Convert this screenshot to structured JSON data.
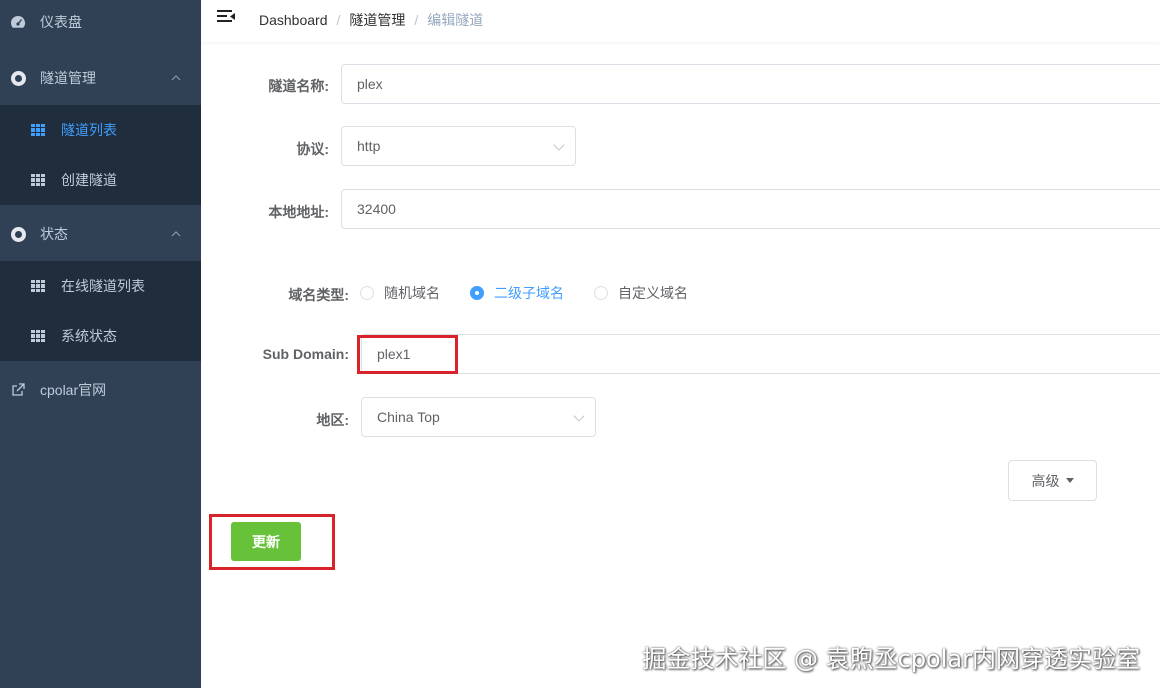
{
  "sidebar": {
    "dashboard": {
      "label": "仪表盘",
      "icon": "gauge-icon"
    },
    "tunnel_mgmt": {
      "label": "隧道管理",
      "icon": "lifebuoy-icon"
    },
    "tunnel_list": {
      "label": "隧道列表",
      "icon": "grid-icon",
      "active": true
    },
    "create_tunnel": {
      "label": "创建隧道",
      "icon": "grid-icon"
    },
    "status": {
      "label": "状态",
      "icon": "lifebuoy-icon"
    },
    "online_tunnels": {
      "label": "在线隧道列表",
      "icon": "grid-icon"
    },
    "system_status": {
      "label": "系统状态",
      "icon": "grid-icon"
    },
    "cpolar_site": {
      "label": "cpolar官网",
      "icon": "external-link-icon"
    }
  },
  "breadcrumb": [
    "Dashboard",
    "隧道管理",
    "编辑隧道"
  ],
  "form": {
    "tunnel_name": {
      "label": "隧道名称:",
      "value": "plex"
    },
    "protocol": {
      "label": "协议:",
      "value": "http"
    },
    "local_address": {
      "label": "本地地址:",
      "value": "32400"
    },
    "domain_type": {
      "label": "域名类型:",
      "options": [
        "随机域名",
        "二级子域名",
        "自定义域名"
      ],
      "selected": "二级子域名"
    },
    "sub_domain": {
      "label": "Sub Domain:",
      "value": "plex1"
    },
    "region": {
      "label": "地区:",
      "value": "China Top"
    },
    "advanced_label": "高级",
    "update_label": "更新"
  },
  "colors": {
    "sidebar_bg": "#304156",
    "submenu_bg": "#1f2d3d",
    "accent": "#409eff",
    "update_button": "#67c23a",
    "highlight_box": "#d9232b"
  },
  "watermark": "掘金技术社区 @ 袁煦丞cpolar内网穿透实验室"
}
